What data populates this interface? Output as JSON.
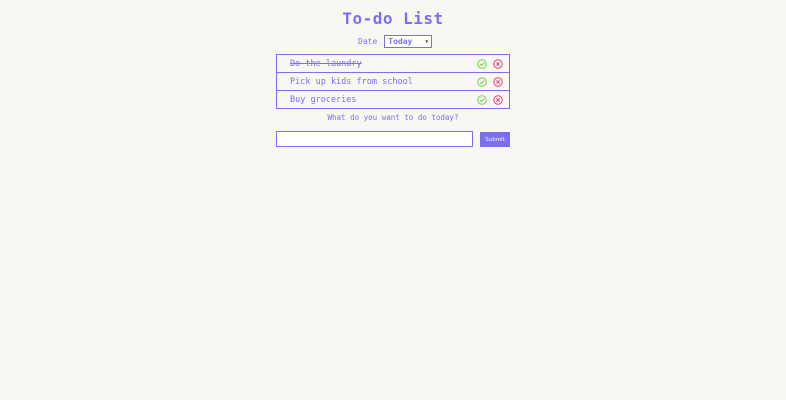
{
  "header": {
    "title": "To-do List"
  },
  "date_filter": {
    "label": "Date",
    "selected": "Today"
  },
  "todos": [
    {
      "text": "Do the laundry",
      "done": true
    },
    {
      "text": "Pick up kids from school",
      "done": false
    },
    {
      "text": "Buy groceries",
      "done": false
    }
  ],
  "form": {
    "prompt": "What do you want to do today?",
    "input_value": "",
    "submit_label": "Submit"
  },
  "colors": {
    "accent": "#7b6ef0",
    "check": "#6fd14a",
    "delete": "#e0407a",
    "background": "#f8f7f2"
  },
  "icons": {
    "complete": "check-circle-icon",
    "delete": "x-circle-icon",
    "dropdown": "caret-down-icon"
  }
}
